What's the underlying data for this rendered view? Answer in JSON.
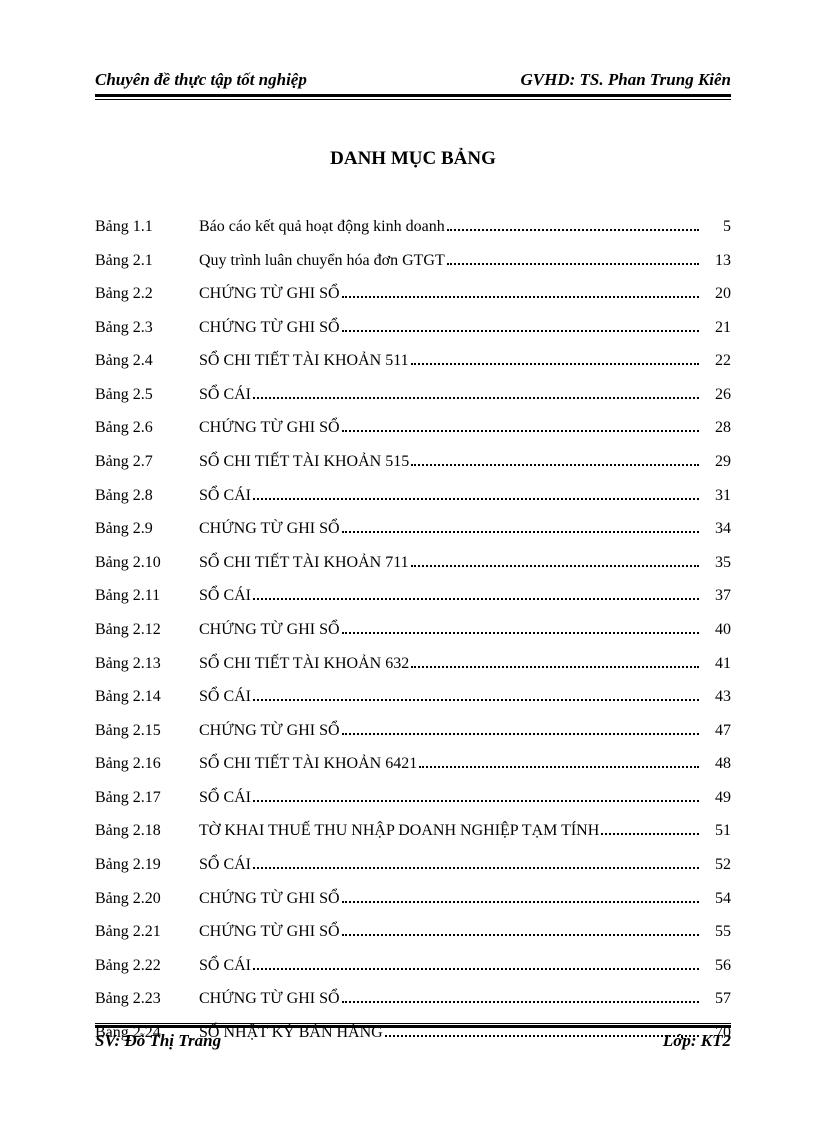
{
  "header": {
    "left": "Chuyên đề thực tập tốt nghiệp",
    "right": "GVHD: TS. Phan Trung Kiên"
  },
  "title": "DANH MỤC BẢNG",
  "toc": [
    {
      "label": "Bảng 1.1",
      "desc": "Báo cáo kết quả hoạt động kinh doanh",
      "page": "5"
    },
    {
      "label": "Bảng 2.1",
      "desc": "Quy trình luân chuyển hóa đơn GTGT",
      "page": "13"
    },
    {
      "label": "Bảng 2.2",
      "desc": "CHỨNG TỪ GHI SỔ",
      "page": "20"
    },
    {
      "label": "Bảng 2.3",
      "desc": "CHỨNG TỪ GHI SỔ",
      "page": "21"
    },
    {
      "label": "Bảng 2.4",
      "desc": "SỔ CHI TIẾT TÀI KHOẢN 511",
      "page": "22"
    },
    {
      "label": "Bảng 2.5",
      "desc": "SỔ CÁI",
      "page": "26"
    },
    {
      "label": "Bảng 2.6",
      "desc": "CHỨNG TỪ GHI SỔ",
      "page": "28"
    },
    {
      "label": "Bảng 2.7",
      "desc": "SỔ CHI TIẾT TÀI KHOẢN 515",
      "page": "29"
    },
    {
      "label": "Bảng 2.8",
      "desc": "SỔ CÁI",
      "page": "31"
    },
    {
      "label": "Bảng 2.9",
      "desc": "CHỨNG TỪ GHI SỔ",
      "page": "34"
    },
    {
      "label": "Bảng 2.10",
      "desc": "SỔ CHI TIẾT TÀI KHOẢN 711",
      "page": "35"
    },
    {
      "label": "Bảng 2.11",
      "desc": "SỔ CÁI",
      "page": "37"
    },
    {
      "label": "Bảng 2.12",
      "desc": "CHỨNG TỪ GHI SỔ",
      "page": "40"
    },
    {
      "label": "Bảng 2.13",
      "desc": "SỔ CHI TIẾT TÀI KHOẢN 632",
      "page": "41"
    },
    {
      "label": "Bảng 2.14",
      "desc": "SỔ CÁI",
      "page": "43"
    },
    {
      "label": "Bảng 2.15",
      "desc": "CHỨNG TỪ GHI SỔ",
      "page": "47"
    },
    {
      "label": "Bảng 2.16",
      "desc": "SỔ CHI TIẾT TÀI KHOẢN 6421",
      "page": "48"
    },
    {
      "label": "Bảng 2.17",
      "desc": "SỔ CÁI",
      "page": "49"
    },
    {
      "label": "Bảng 2.18",
      "desc": "TỜ KHAI THUẾ THU NHẬP DOANH NGHIỆP TẠM TÍNH",
      "page": "51"
    },
    {
      "label": "Bảng 2.19",
      "desc": "SỔ CÁI",
      "page": "52"
    },
    {
      "label": "Bảng 2.20",
      "desc": "CHỨNG TỪ GHI SỔ",
      "page": "54"
    },
    {
      "label": "Bảng 2.21",
      "desc": "CHỨNG TỪ GHI SỔ",
      "page": "55"
    },
    {
      "label": "Bảng 2.22",
      "desc": "SỔ CÁI",
      "page": "56"
    },
    {
      "label": "Bảng 2.23",
      "desc": "CHỨNG TỪ GHI SỔ",
      "page": "57"
    },
    {
      "label": "Bảng 2.24",
      "desc": "SỔ NHẬT KÝ BÁN HÀNG",
      "page": "70"
    }
  ],
  "footer": {
    "left": "SV: Đỗ Thị Trang",
    "right": "Lớp: KT2"
  }
}
